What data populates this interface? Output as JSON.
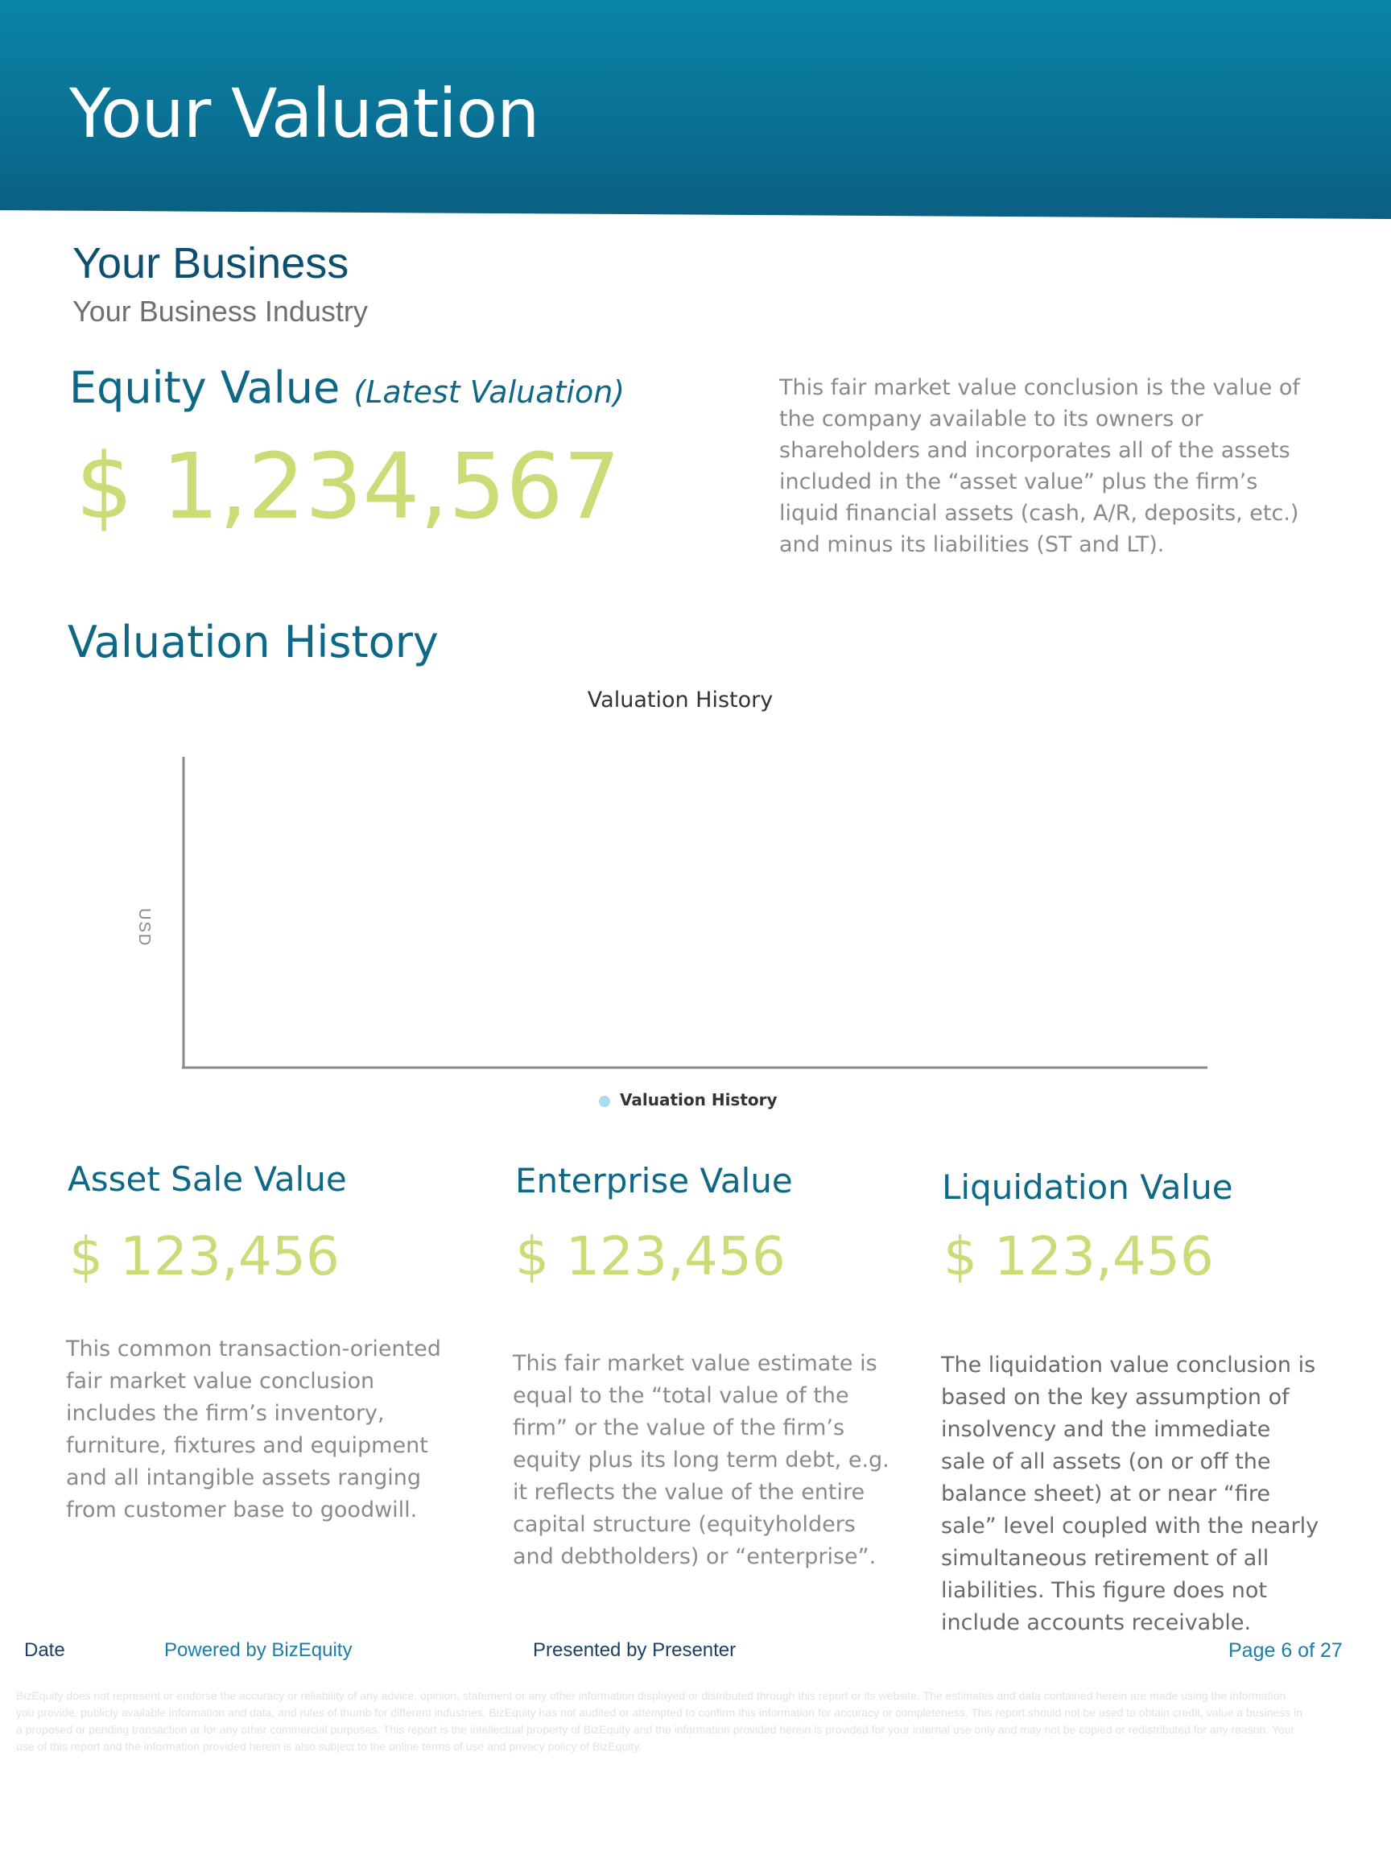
{
  "header": {
    "title": "Your Valuation"
  },
  "business": {
    "name": "Your Business",
    "industry": "Your Business Industry"
  },
  "equity": {
    "heading": "Equity Value",
    "heading_sub": "(Latest Valuation)",
    "value": "$ 1,234,567",
    "description": "This fair market value conclusion is the value of the company available to its owners or shareholders and incorporates all of the assets included in the “asset value” plus the firm’s liquid financial assets (cash, A/R, deposits, etc.) and minus its liabilities (ST and LT)."
  },
  "history": {
    "heading": "Valuation History"
  },
  "chart_data": {
    "type": "line",
    "title": "Valuation History",
    "ylabel": "USD",
    "xlabel": "",
    "series": [
      {
        "name": "Valuation History",
        "values": []
      }
    ],
    "legend_position": "bottom-center",
    "grid": false,
    "series_color": "#a8dcee"
  },
  "values": [
    {
      "heading": "Asset Sale Value",
      "value": "$ 123,456",
      "description": "This common transaction-oriented fair market value conclusion includes the firm’s inventory, furniture, fixtures and equipment and all intangible assets ranging from customer base to goodwill."
    },
    {
      "heading": "Enterprise Value",
      "value": "$ 123,456",
      "description": "This fair market value estimate is equal to the “total value of the firm” or the value of the firm’s equity plus its long term debt, e.g. it reflects the value of the entire capital structure (equityholders and debtholders) or “enterprise”."
    },
    {
      "heading": "Liquidation Value",
      "value": "$ 123,456",
      "description": "The liquidation value conclusion is based on the key assumption of insolvency and the immediate sale of all assets (on or off the balance sheet) at or near “fire sale” level coupled with the nearly simultaneous retirement of all liabilities. This figure does not include accounts receivable."
    }
  ],
  "footer": {
    "date": "Date",
    "powered": "Powered by BizEquity",
    "presented": "Presented by Presenter",
    "page": "Page 6 of 27"
  },
  "disclaimer": "BizEquity does not represent or endorse the accuracy or reliability of any advice, opinion, statement or any other information displayed or distributed through this report or its website. The estimates and data contained herein are made using the information you provide, publicly available information and data, and rules of thumb for different industries. BizEquity has not audited or attempted to confirm this information for accuracy or completeness. This report should not be used to obtain credit, value a business in a proposed or pending transaction or for any other commercial purposes. This report is the intellectual property of BizEquity and the information provided herein is provided for your internal use only and may not be copied or redistributed for any reason. Your use of this report and the information provided herein is also subject to the online terms of use and privacy policy of BizEquity."
}
